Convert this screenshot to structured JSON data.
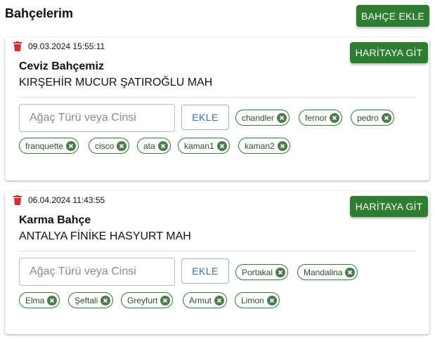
{
  "header": {
    "title": "Bahçelerim",
    "add_button": "BAHÇE EKLE"
  },
  "colors": {
    "primary": "#2e7d32",
    "danger": "#d32f2f",
    "outline_button": "#3a6fa8"
  },
  "gardens": [
    {
      "date": "09.03.2024 15:55:11",
      "map_button": "HARİTAYA GİT",
      "name": "Ceviz Bahçemiz",
      "address": "KIRŞEHİR MUCUR ŞATIROĞLU MAH",
      "input_placeholder": "Ağaç Türü veya Cinsi",
      "add_label": "EKLE",
      "trees": [
        "chandler",
        "fernor",
        "pedro",
        "franquette",
        "cisco",
        "ata",
        "kaman1",
        "kaman2"
      ]
    },
    {
      "date": "06.04.2024 11:43:55",
      "map_button": "HARİTAYA GİT",
      "name": "Karma Bahçe",
      "address": "ANTALYA FİNİKE HASYURT MAH",
      "input_placeholder": "Ağaç Türü veya Cinsi",
      "add_label": "EKLE",
      "trees": [
        "Portakal",
        "Mandalina",
        "Elma",
        "Şeftali",
        "Greyfurt",
        "Armut",
        "Limon"
      ]
    }
  ],
  "icons": {
    "delete": "trash-icon",
    "remove_chip": "cancel-circle-icon"
  }
}
